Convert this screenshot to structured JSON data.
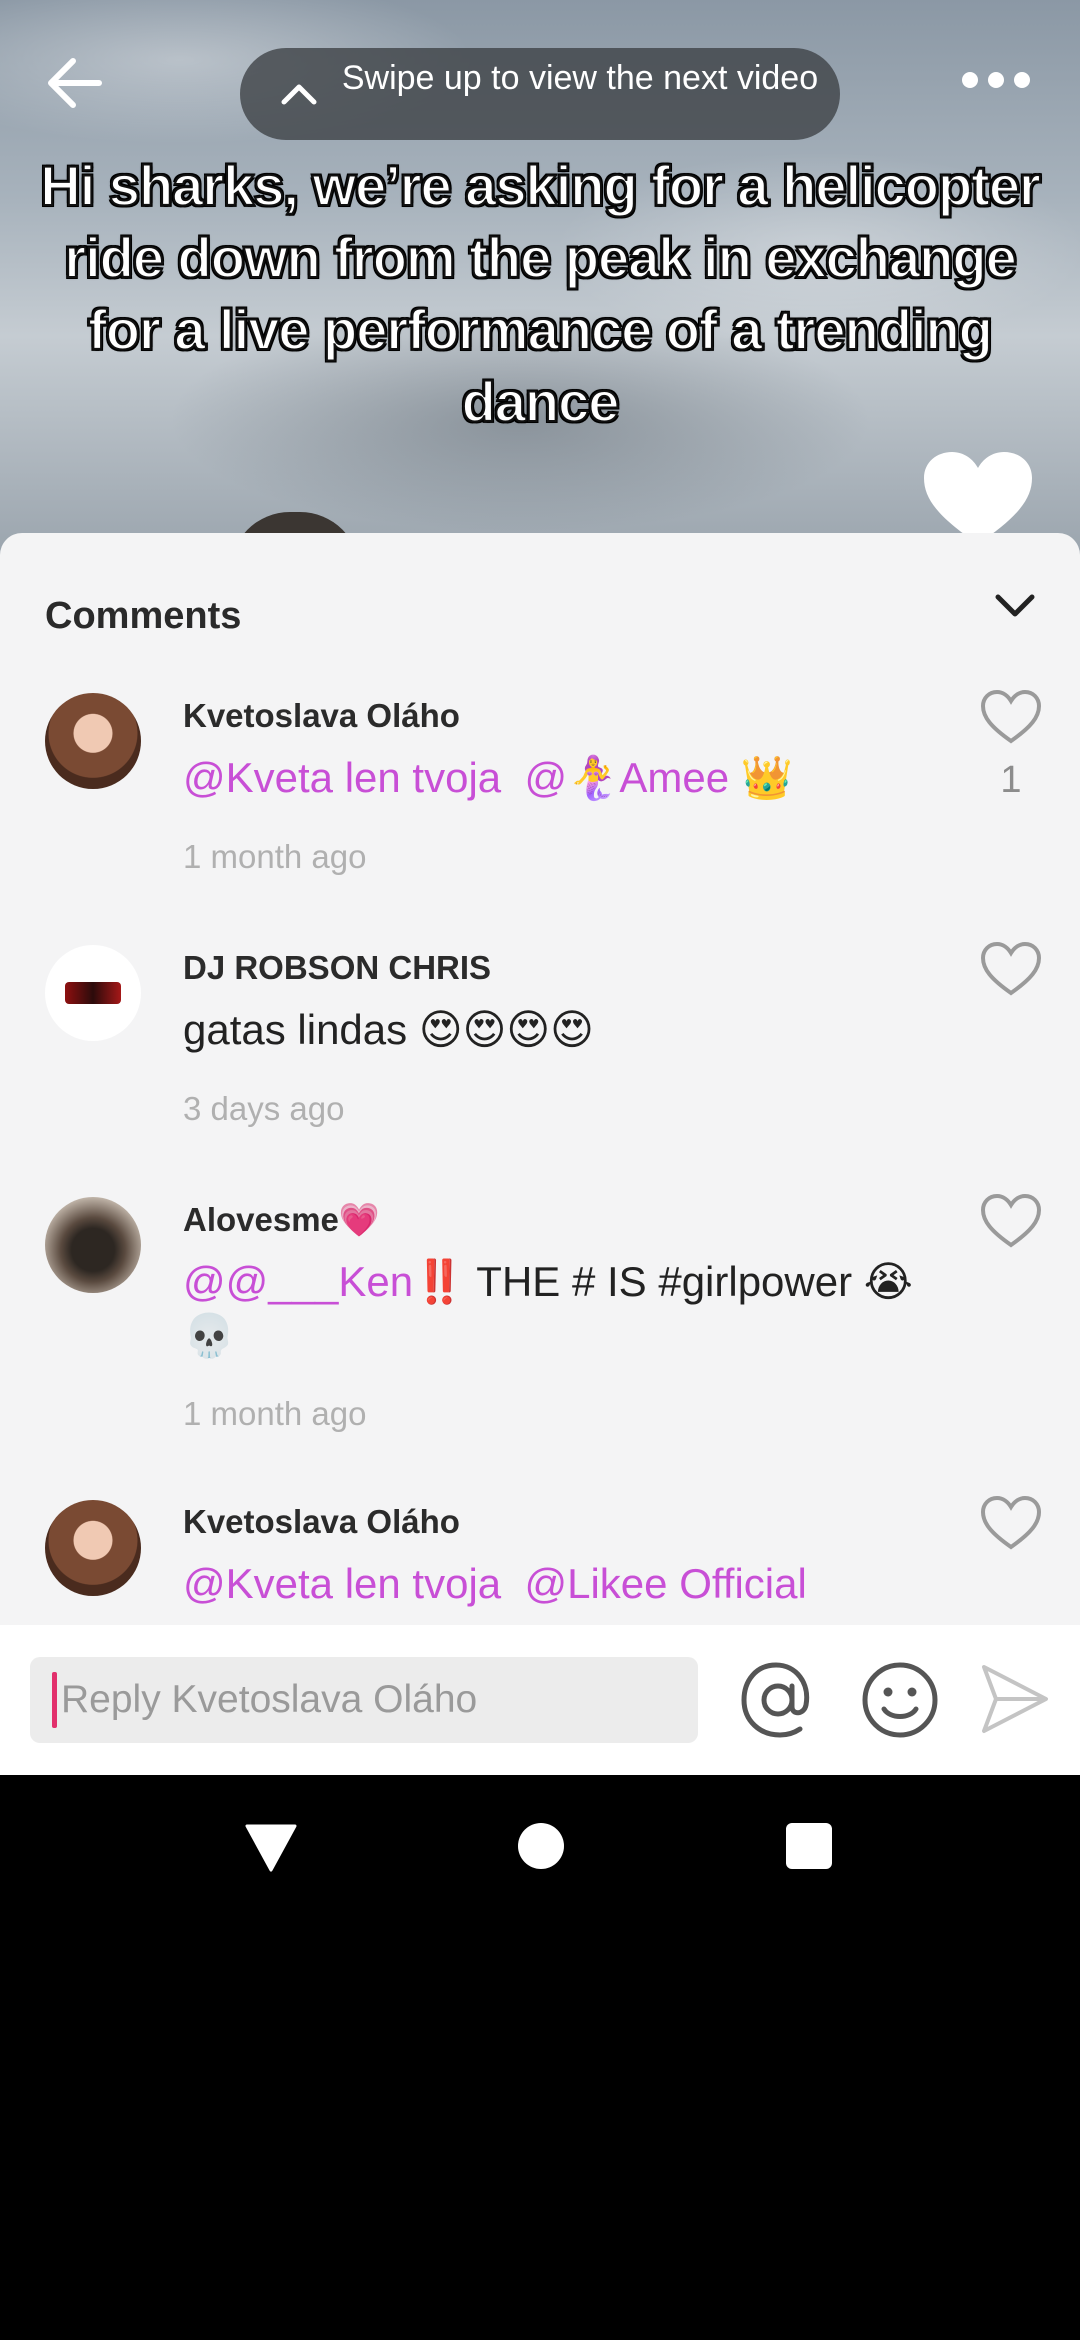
{
  "video": {
    "swipe_hint": "Swipe up to view the next video",
    "caption": "Hi sharks, we’re asking for a helicopter ride down from the peak in exchange for a live performance of a trending dance"
  },
  "comments_panel": {
    "title": "Comments",
    "comments": [
      {
        "username": "Kvetoslava Oláho",
        "mention1": "@Kveta len tvoja",
        "mention2": "@🧜‍♀️Amee",
        "trailing": "👑",
        "time": "1 month ago",
        "likes": "1"
      },
      {
        "username": "DJ ROBSON CHRIS",
        "text": "gatas lindas 😍😍😍😍",
        "time": "3 days ago"
      },
      {
        "username": "Alovesme💗",
        "mention": "@@___Ken",
        "text": "‼️ THE # IS #girlpower 😭💀",
        "time": "1 month ago"
      },
      {
        "username": "Kvetoslava Oláho",
        "mention1": "@Kveta len tvoja",
        "mention2": "@Likee Official"
      }
    ]
  },
  "reply": {
    "placeholder": "Reply Kvetoslava Oláho"
  },
  "colors": {
    "mention": "#c84fd6",
    "sheet_bg": "#f4f4f5",
    "caret": "#e2306c"
  }
}
